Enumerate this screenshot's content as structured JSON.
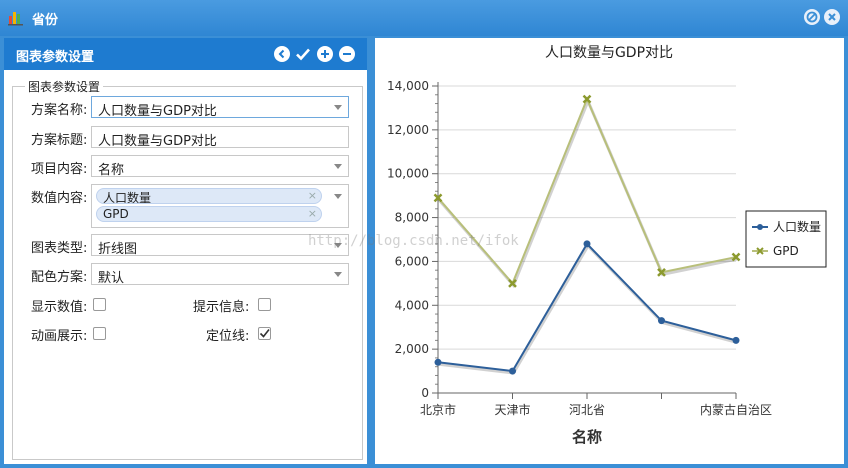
{
  "window": {
    "title": "省份",
    "colors": {
      "titlebar": "#2f86d3",
      "panel_header": "#1e7bd0"
    }
  },
  "panel": {
    "header_title": "图表参数设置",
    "header_icons": [
      "back-icon",
      "check-icon",
      "add-icon",
      "remove-icon"
    ],
    "legend": "图表参数设置",
    "fields": {
      "scheme_name": {
        "label": "方案名称:",
        "value": "人口数量与GDP对比"
      },
      "scheme_title": {
        "label": "方案标题:",
        "value": "人口数量与GDP对比"
      },
      "item_content": {
        "label": "项目内容:",
        "value": "名称"
      },
      "value_content": {
        "label": "数值内容:",
        "tags": [
          "人口数量",
          "GPD"
        ]
      },
      "chart_type": {
        "label": "图表类型:",
        "value": "折线图"
      },
      "color_scheme": {
        "label": "配色方案:",
        "value": "默认"
      },
      "show_values": {
        "label": "显示数值:",
        "checked": false
      },
      "tooltip": {
        "label": "提示信息:",
        "checked": false
      },
      "animation": {
        "label": "动画展示:",
        "checked": false
      },
      "locator_line": {
        "label": "定位线:",
        "checked": true
      }
    }
  },
  "watermark": "http://blog.csdn.net/ifok",
  "chart_data": {
    "type": "line",
    "title": "人口数量与GDP对比",
    "xlabel": "名称",
    "ylabel": "",
    "categories": [
      "北京市",
      "天津市",
      "河北省",
      "",
      "内蒙古自治区"
    ],
    "ylim": [
      0,
      14000
    ],
    "yticks": [
      "0",
      "2,000",
      "4,000",
      "6,000",
      "8,000",
      "10,000",
      "12,000",
      "14,000"
    ],
    "grid": true,
    "legend_position": "right",
    "series": [
      {
        "name": "人口数量",
        "values": [
          1400,
          1000,
          6800,
          3300,
          2400
        ],
        "color": "#2d5f9a"
      },
      {
        "name": "GPD",
        "values": [
          8900,
          5000,
          13400,
          5500,
          6200
        ],
        "color": "#b8bf7a"
      }
    ]
  }
}
